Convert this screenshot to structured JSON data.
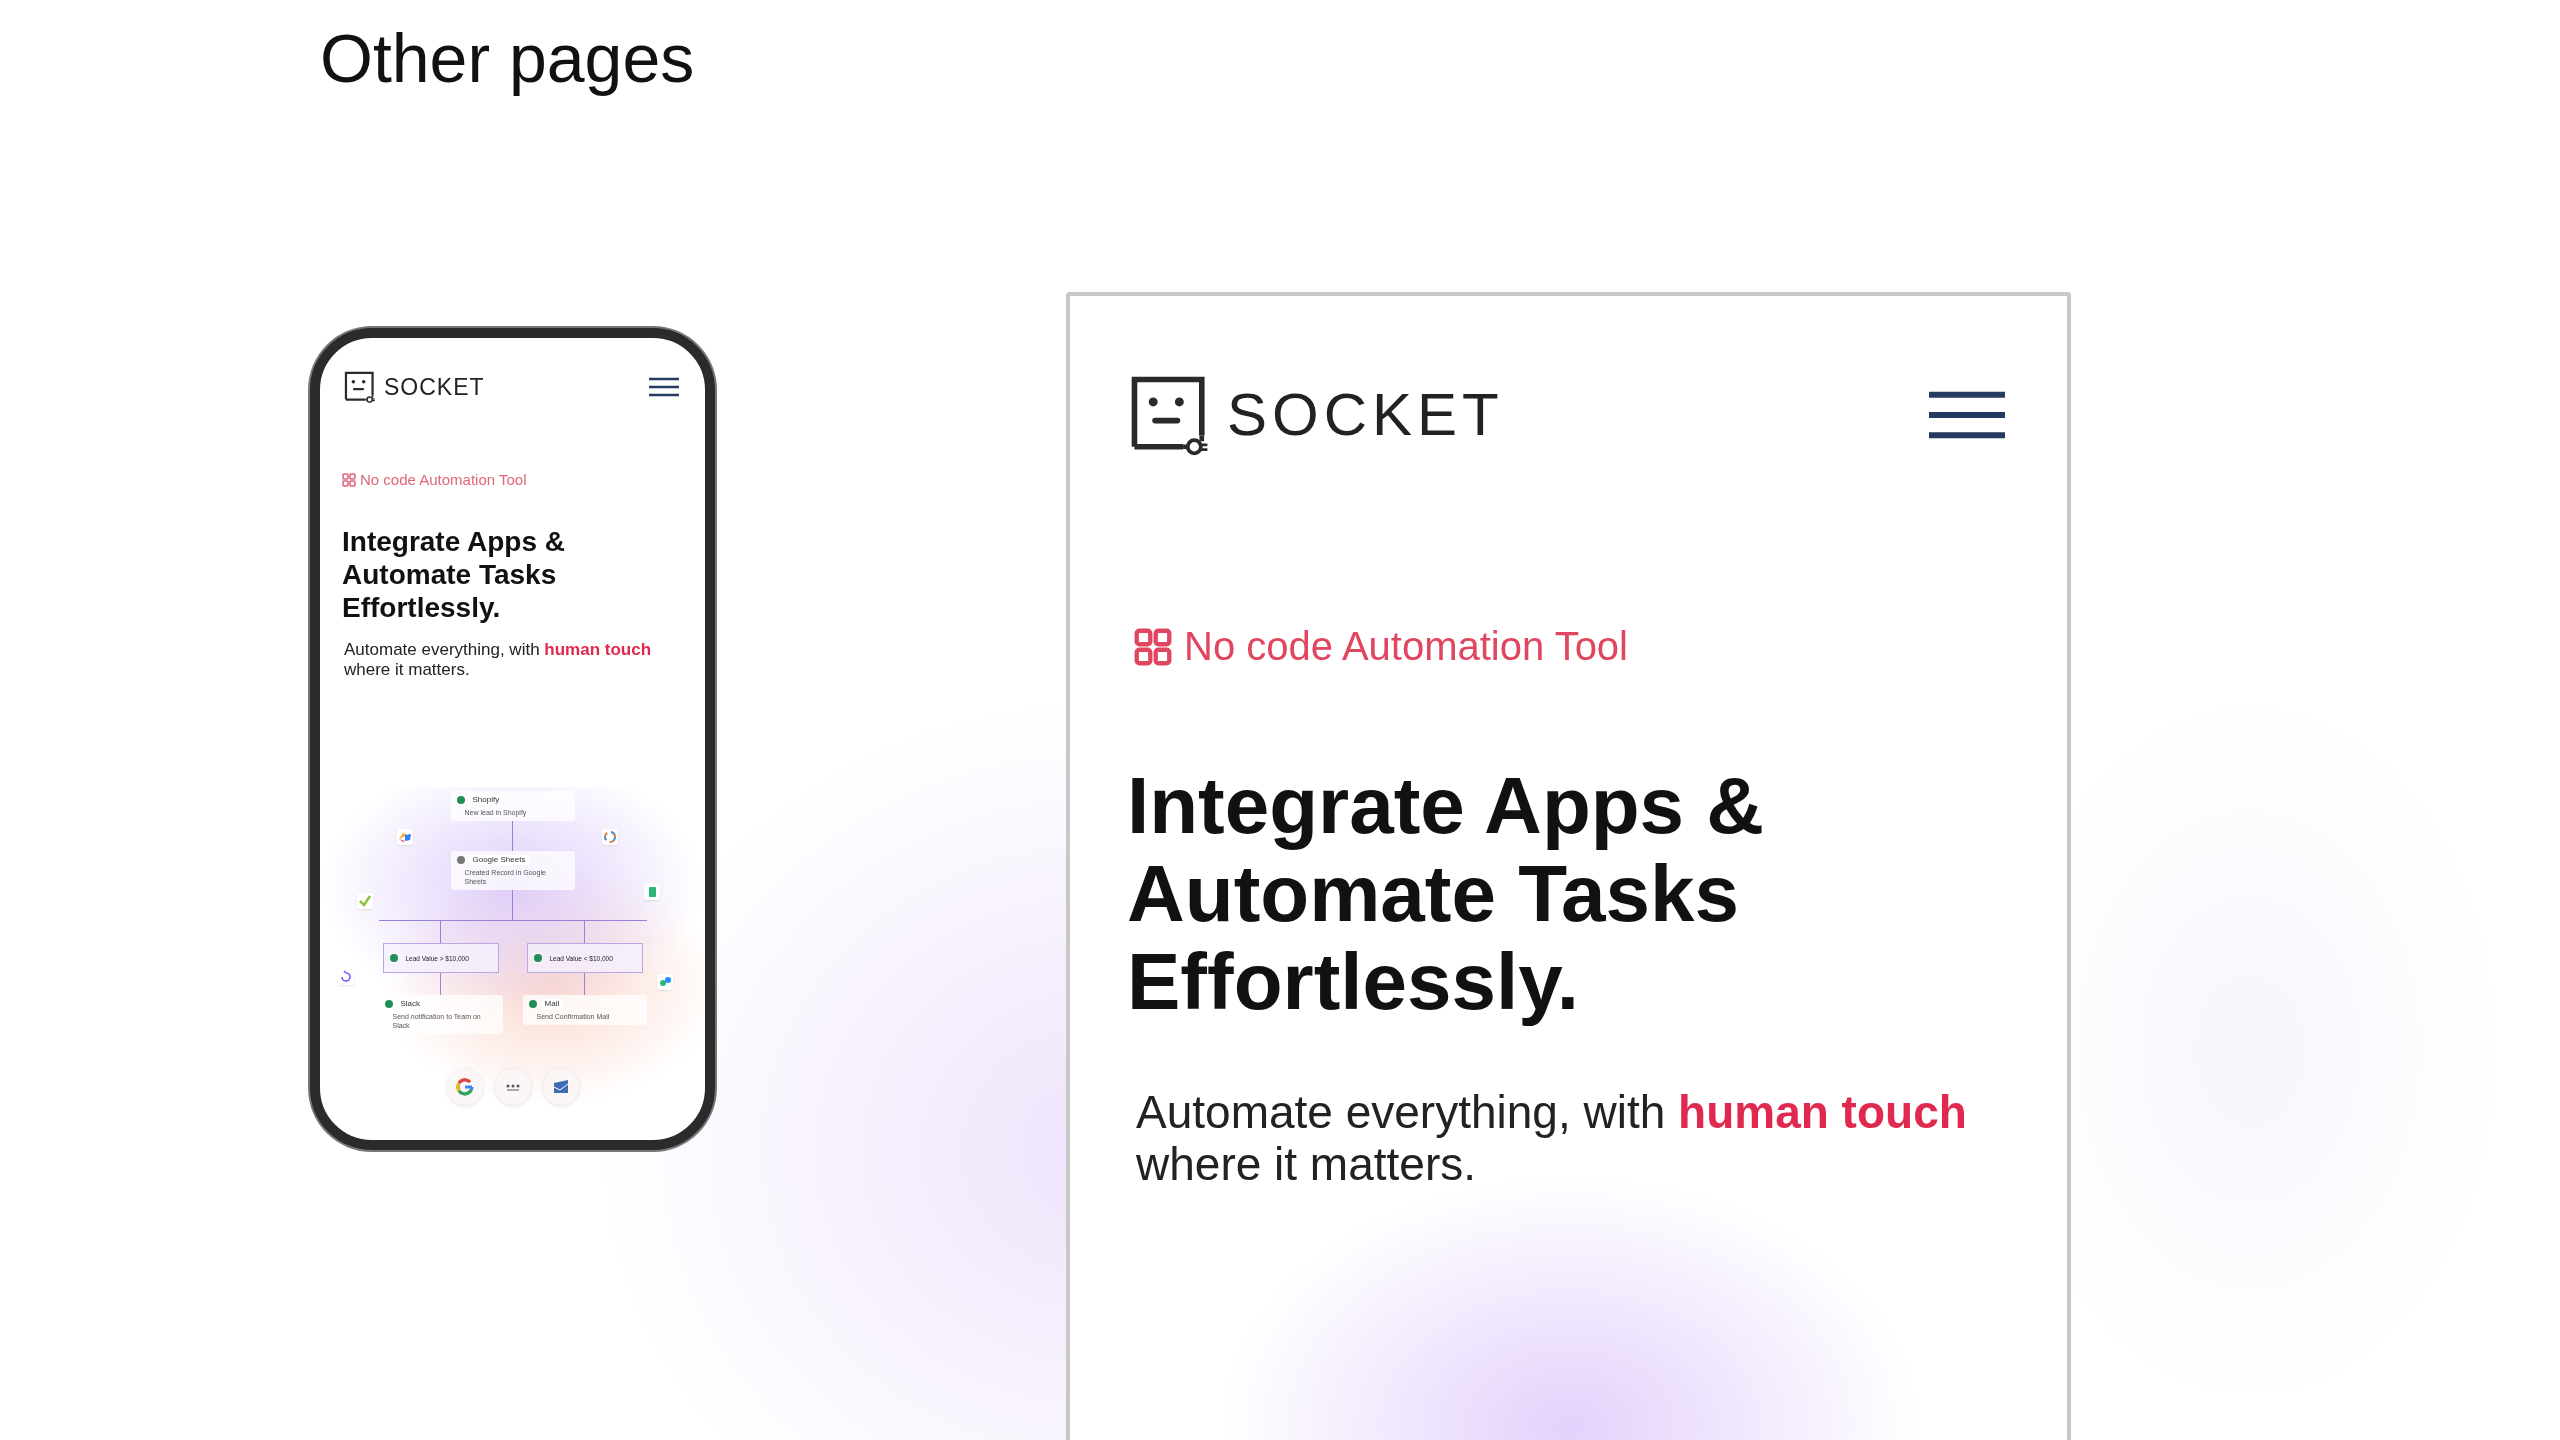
{
  "page_title": "Other pages",
  "mobile_preview": {
    "logo_text": "SOCKET",
    "tag": "No code Automation Tool",
    "heading": [
      "Integrate Apps &",
      "Automate Tasks",
      "Effortlessly."
    ],
    "subtitle": {
      "lead": "Automate everything, with",
      "highlight": "human touch",
      "rest": "where it matters."
    },
    "workflow": {
      "steps": [
        {
          "app": "Shopify",
          "description": "New lead in Shopify",
          "checked": true
        },
        {
          "app": "Google Sheets",
          "description": "Created Record in Google Sheets",
          "checked": false
        }
      ],
      "branches": [
        {
          "condition": "Lead Value > $10,000",
          "checked": true,
          "action": {
            "app": "Slack",
            "description": "Send notification to Team on Slack",
            "checked": true
          }
        },
        {
          "condition": "Lead Value < $10,000",
          "checked": true,
          "action": {
            "app": "Mail",
            "description": "Send Confirmation Mail",
            "checked": true
          }
        }
      ]
    }
  },
  "tablet_preview": {
    "logo_text": "SOCKET",
    "tag": "No code Automation Tool",
    "heading": [
      "Integrate Apps &",
      "Automate Tasks",
      "Effortlessly."
    ],
    "subtitle": {
      "lead": "Automate everything, with",
      "highlight": "human touch",
      "rest": "where it matters."
    }
  }
}
